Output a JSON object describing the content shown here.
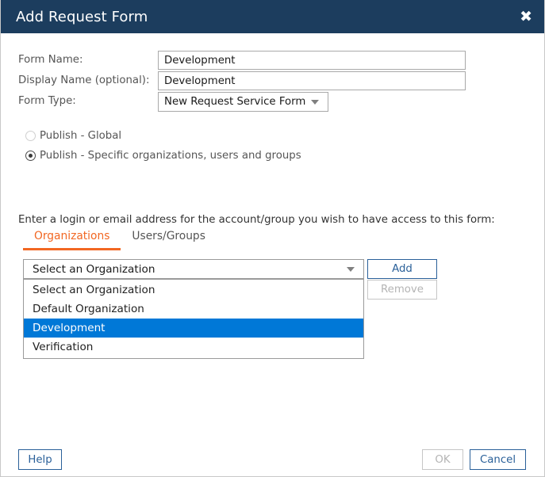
{
  "window": {
    "title": "Add Request Form",
    "close_icon": "close-icon",
    "close_glyph": "✖",
    "titlebar_color": "#1c3d5e"
  },
  "form": {
    "fields": [
      {
        "label": "Form Name:",
        "value": "Development",
        "type": "text"
      },
      {
        "label": "Display Name (optional):",
        "value": "Development",
        "type": "text"
      },
      {
        "label": "Form Type:",
        "value": "New Request Service Form",
        "type": "select"
      }
    ]
  },
  "publish": {
    "options": [
      {
        "label": "Publish - Global",
        "selected": false
      },
      {
        "label": "Publish - Specific organizations, users and groups",
        "selected": true
      }
    ]
  },
  "instruction": "Enter a login or email address for the account/group you wish to have access to this form:",
  "tabs": {
    "active_color": "#f26722",
    "items": [
      {
        "label": "Organizations",
        "active": true
      },
      {
        "label": "Users/Groups",
        "active": false
      }
    ]
  },
  "organization_select": {
    "value": "Select an Organization",
    "caret_icon": "chevron-down-icon",
    "options": [
      {
        "label": "Select an Organization",
        "highlighted": false
      },
      {
        "label": "Default Organization",
        "highlighted": false
      },
      {
        "label": "Development",
        "highlighted": true
      },
      {
        "label": "Verification",
        "highlighted": false
      }
    ],
    "highlight_color": "#0078d7"
  },
  "side_buttons": {
    "add_label": "Add",
    "remove_label": "Remove"
  },
  "footer": {
    "help_label": "Help",
    "ok_label": "OK",
    "cancel_label": "Cancel"
  }
}
